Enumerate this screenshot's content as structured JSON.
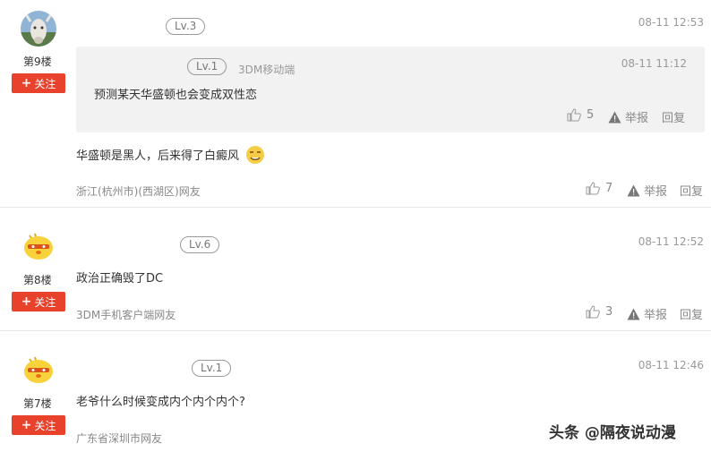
{
  "follow_label": "关注",
  "actions": {
    "report": "举报",
    "reply": "回复"
  },
  "comments": [
    {
      "floor": "第9楼",
      "level": "Lv.3",
      "time": "08-11 12:53",
      "quote": {
        "level": "Lv.1",
        "source": "3DM移动端",
        "time": "08-11 11:12",
        "text": "预测某天华盛顿也会变成双性恋",
        "likes": "5"
      },
      "text": "华盛顿是黑人，后来得了白癜风",
      "location": "浙江(杭州市)(西湖区)网友",
      "likes": "7"
    },
    {
      "floor": "第8楼",
      "level": "Lv.6",
      "time": "08-11 12:52",
      "text": "政治正确毁了DC",
      "location": "3DM手机客户端网友",
      "likes": "3"
    },
    {
      "floor": "第7楼",
      "level": "Lv.1",
      "time": "08-11 12:46",
      "text": "老爷什么时候变成内个内个内个?",
      "location": "广东省深圳市网友"
    }
  ],
  "watermark": "头条 @隔夜说动漫"
}
